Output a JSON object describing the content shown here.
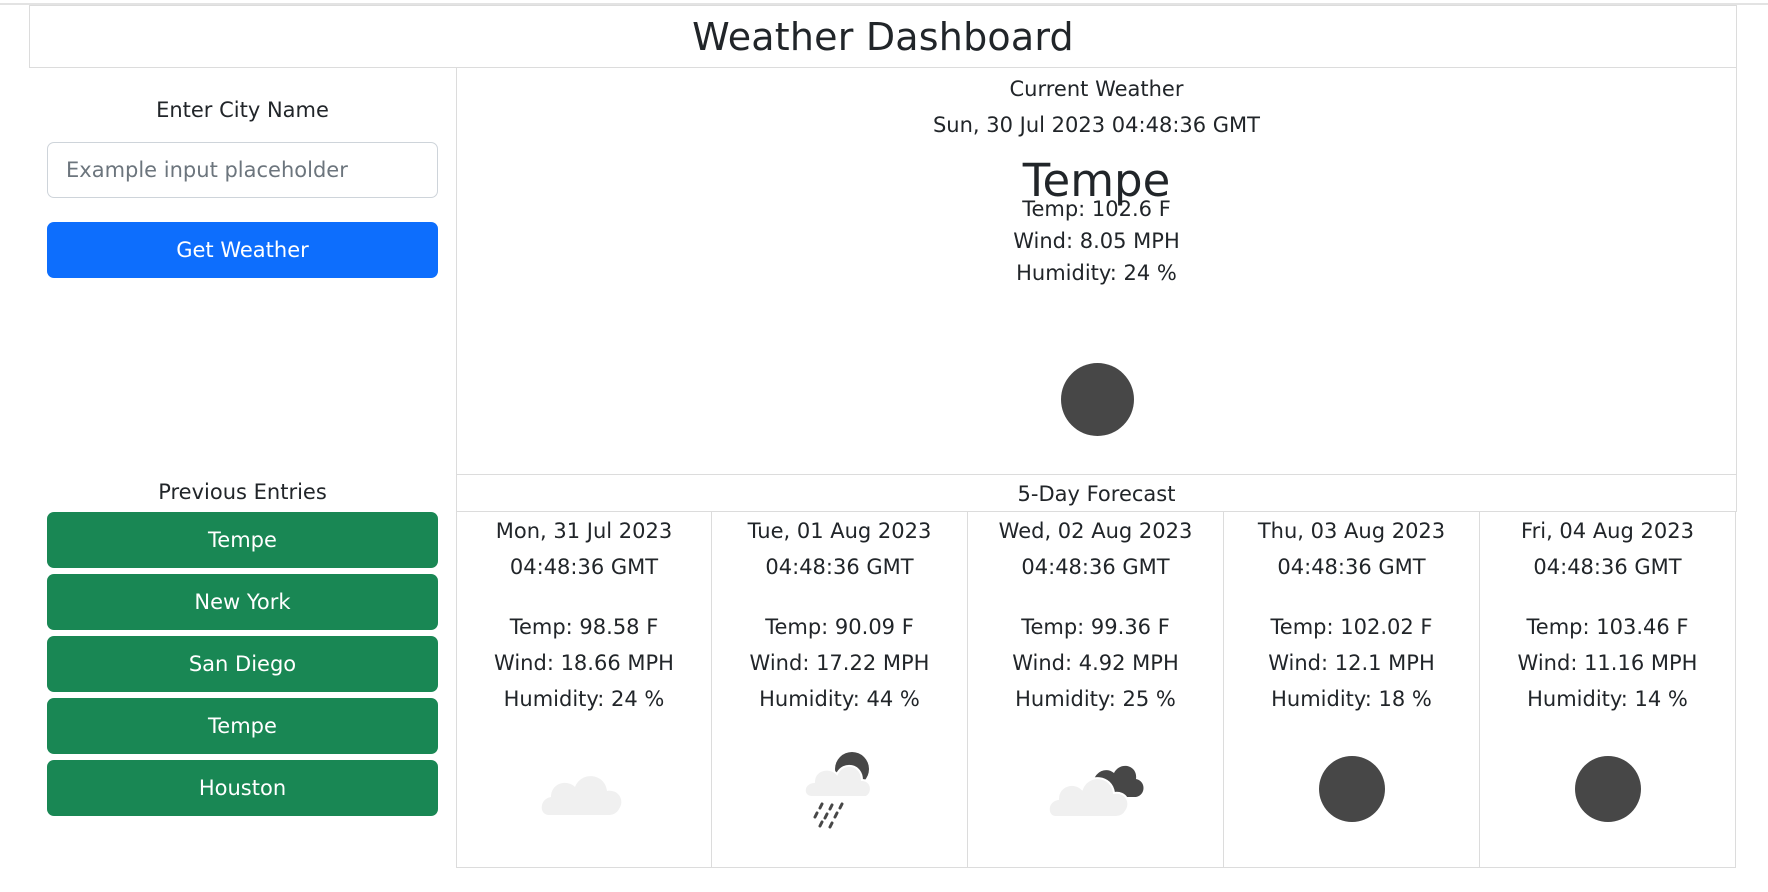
{
  "header": {
    "title": "Weather Dashboard"
  },
  "search": {
    "label": "Enter City Name",
    "placeholder": "Example input placeholder",
    "button_label": "Get Weather"
  },
  "history": {
    "label": "Previous Entries",
    "items": [
      "Tempe",
      "New York",
      "San Diego",
      "Tempe",
      "Houston"
    ]
  },
  "current": {
    "title": "Current Weather",
    "date": "Sun, 30 Jul 2023 04:48:36 GMT",
    "city": "Tempe",
    "temp": "Temp: 102.6 F",
    "wind": "Wind: 8.05 MPH",
    "humidity": "Humidity: 24 %",
    "icon": "clear-night-icon"
  },
  "forecast": {
    "title": "5-Day Forecast",
    "days": [
      {
        "date": "Mon, 31 Jul 2023",
        "time": "04:48:36 GMT",
        "temp": "Temp: 98.58 F",
        "wind": "Wind: 18.66 MPH",
        "humidity": "Humidity: 24 %",
        "icon": "cloud-icon"
      },
      {
        "date": "Tue, 01 Aug 2023",
        "time": "04:48:36 GMT",
        "temp": "Temp: 90.09 F",
        "wind": "Wind: 17.22 MPH",
        "humidity": "Humidity: 44 %",
        "icon": "rain-night-icon"
      },
      {
        "date": "Wed, 02 Aug 2023",
        "time": "04:48:36 GMT",
        "temp": "Temp: 99.36 F",
        "wind": "Wind: 4.92 MPH",
        "humidity": "Humidity: 25 %",
        "icon": "broken-clouds-icon"
      },
      {
        "date": "Thu, 03 Aug 2023",
        "time": "04:48:36 GMT",
        "temp": "Temp: 102.02 F",
        "wind": "Wind: 12.1 MPH",
        "humidity": "Humidity: 18 %",
        "icon": "clear-night-icon"
      },
      {
        "date": "Fri, 04 Aug 2023",
        "time": "04:48:36 GMT",
        "temp": "Temp: 103.46 F",
        "wind": "Wind: 11.16 MPH",
        "humidity": "Humidity: 14 %",
        "icon": "clear-night-icon"
      }
    ]
  },
  "colors": {
    "primary": "#0d6efd",
    "success": "#198754",
    "border": "#dcdcdc",
    "icon_dark": "#474747",
    "icon_light": "#f0f0f0"
  }
}
